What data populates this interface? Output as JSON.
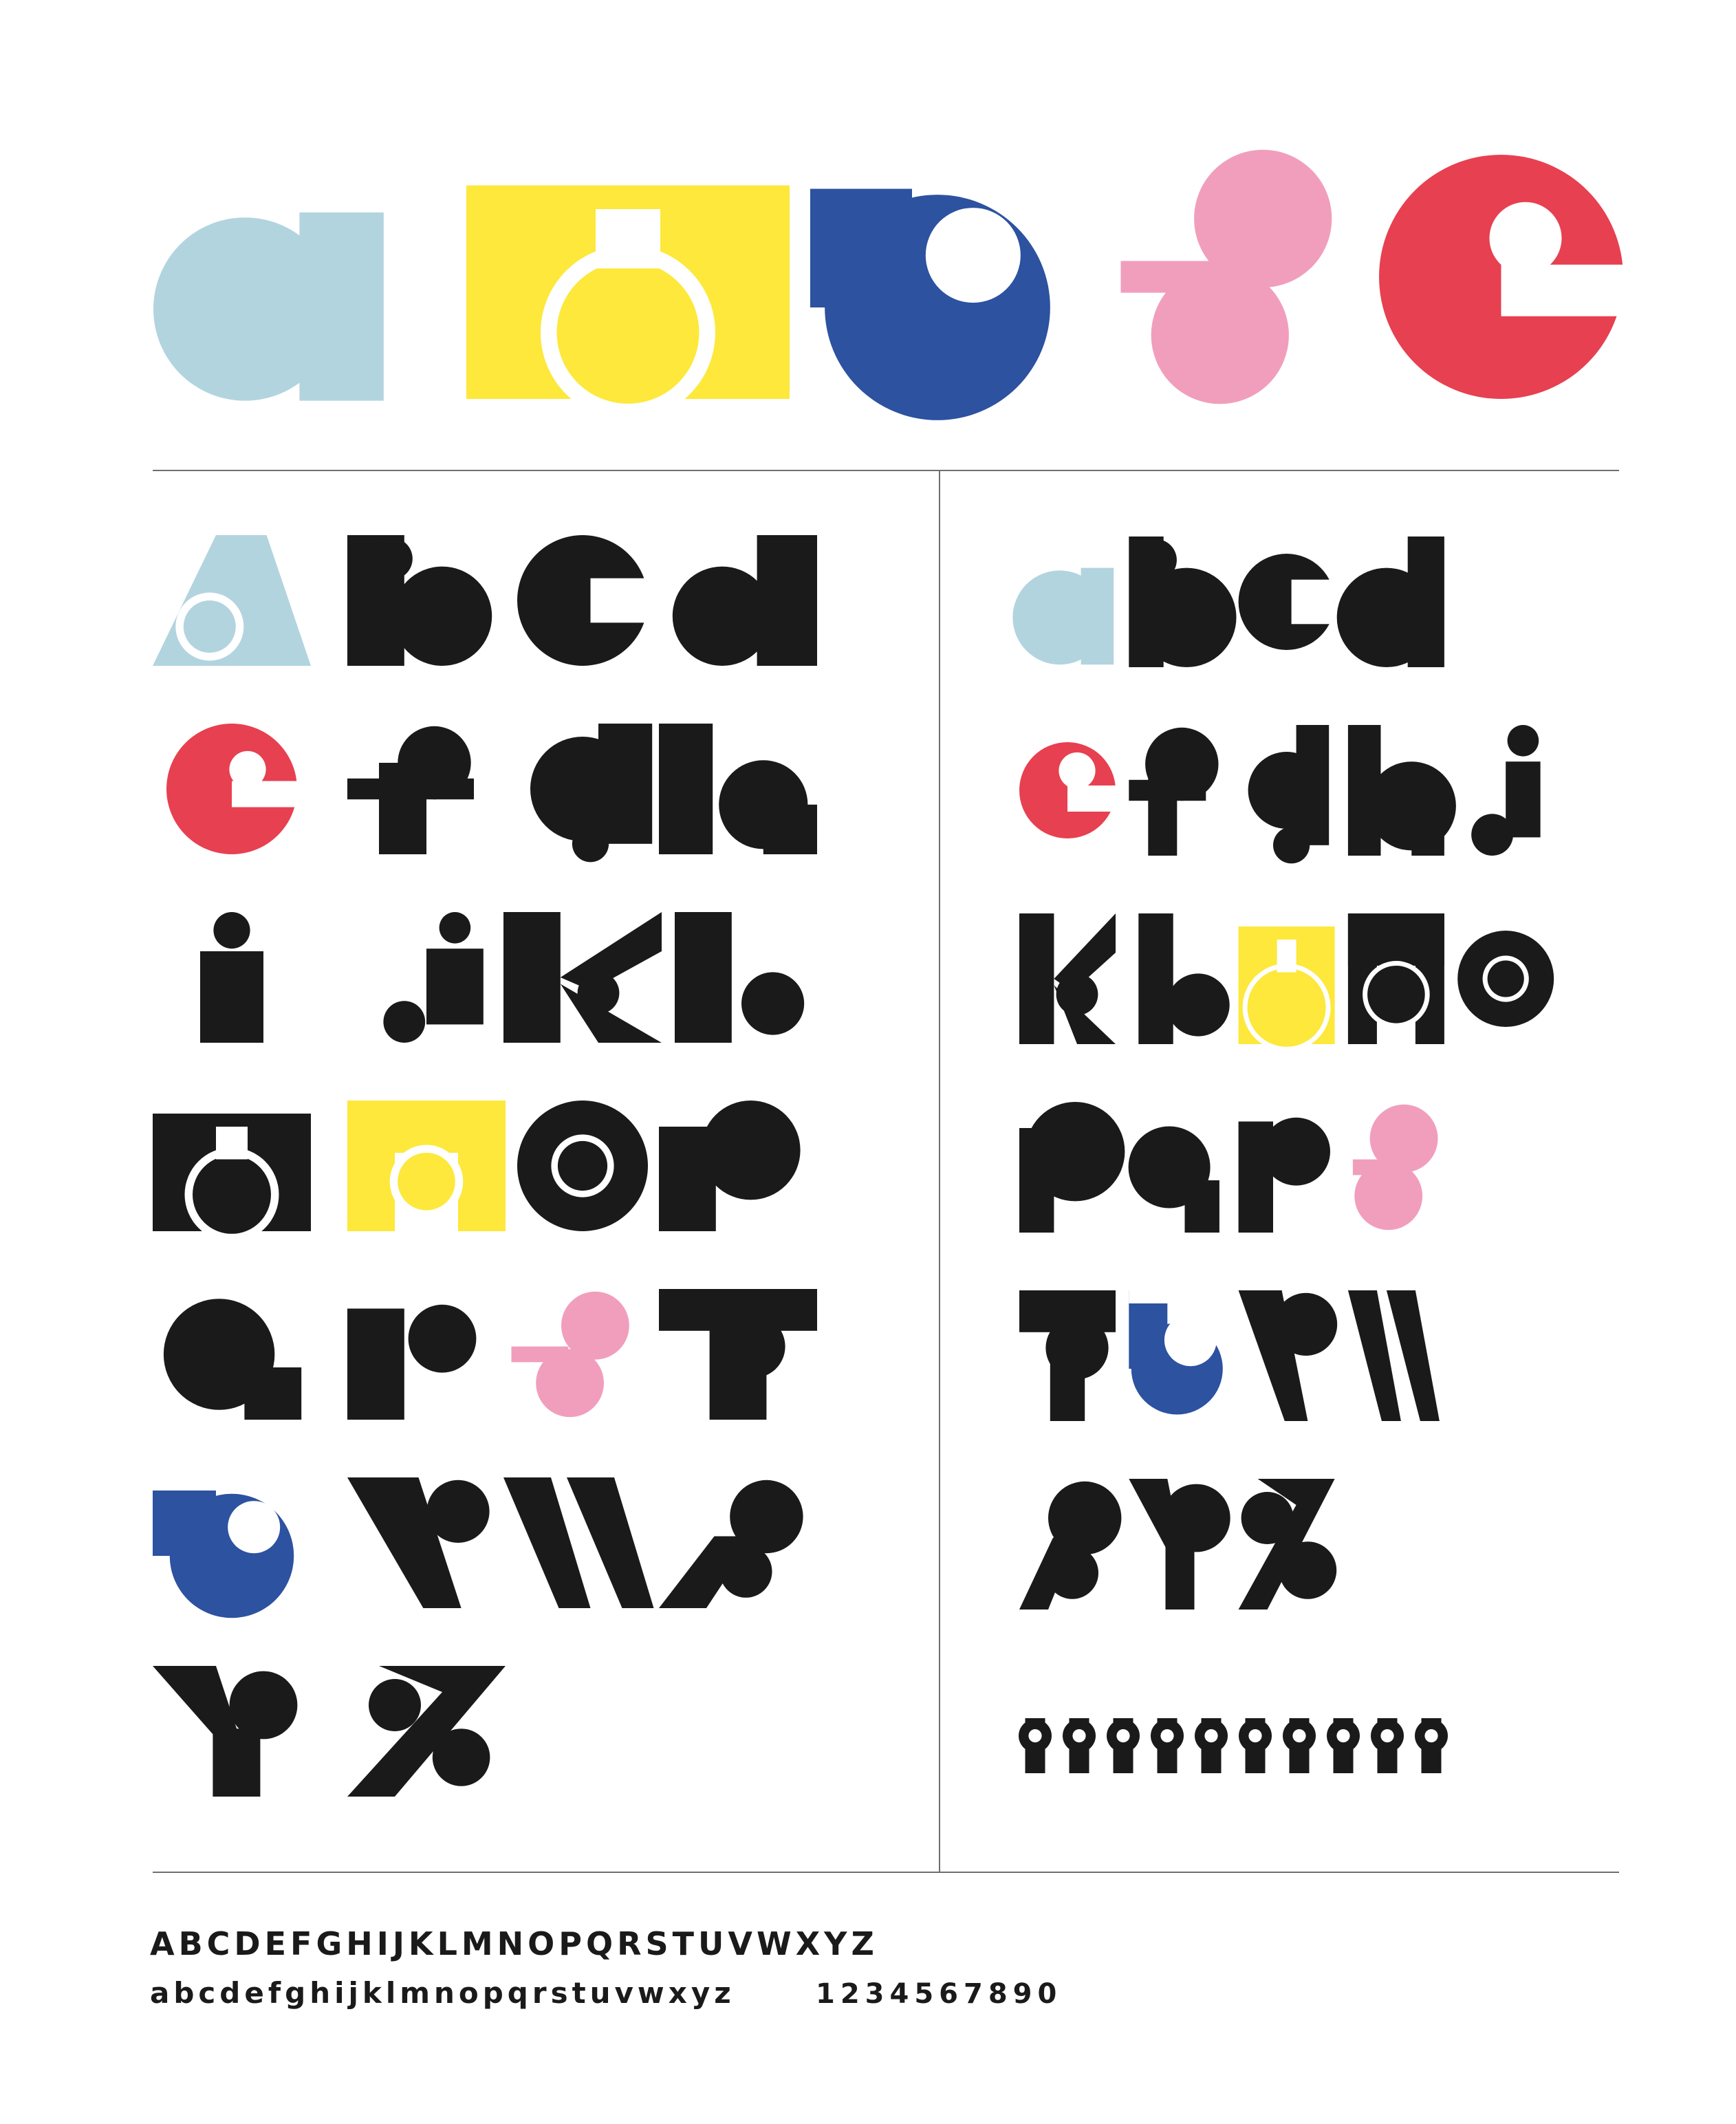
{
  "title": {
    "word": "amuse",
    "letters": [
      {
        "char": "a",
        "color": "#b2d4df"
      },
      {
        "char": "m",
        "color": "#fde83b"
      },
      {
        "char": "u",
        "color": "#2c52a0"
      },
      {
        "char": "s",
        "color": "#f19ebd"
      },
      {
        "char": "e",
        "color": "#e74050"
      }
    ]
  },
  "palette": {
    "ink": "#1a1a1a",
    "blue_light": "#b2d4df",
    "yellow": "#fde83b",
    "blue": "#2c52a0",
    "pink": "#f19ebd",
    "red": "#e74050",
    "rule": "#6e6e6e"
  },
  "uppercase": {
    "rows": [
      [
        {
          "char": "A",
          "color": "blue_light"
        },
        {
          "char": "B"
        },
        {
          "char": "C"
        },
        {
          "char": "D"
        }
      ],
      [
        {
          "char": "E",
          "color": "red"
        },
        {
          "char": "F"
        },
        {
          "char": "G"
        },
        {
          "char": "H"
        }
      ],
      [
        {
          "char": "I"
        },
        {
          "char": "J"
        },
        {
          "char": "K"
        },
        {
          "char": "L"
        }
      ],
      [
        {
          "char": "M"
        },
        {
          "char": "N",
          "color": "yellow"
        },
        {
          "char": "O"
        },
        {
          "char": "P"
        }
      ],
      [
        {
          "char": "Q"
        },
        {
          "char": "R"
        },
        {
          "char": "S",
          "color": "pink"
        },
        {
          "char": "T"
        }
      ],
      [
        {
          "char": "U",
          "color": "blue"
        },
        {
          "char": "V"
        },
        {
          "char": "W"
        },
        {
          "char": "X"
        }
      ],
      [
        {
          "char": "Y"
        },
        {
          "char": "Z"
        }
      ]
    ]
  },
  "lowercase": {
    "rows": [
      [
        {
          "char": "a",
          "color": "blue_light"
        },
        {
          "char": "b"
        },
        {
          "char": "c"
        },
        {
          "char": "d"
        }
      ],
      [
        {
          "char": "e",
          "color": "red"
        },
        {
          "char": "f"
        },
        {
          "char": "g"
        },
        {
          "char": "h"
        },
        {
          "char": "j"
        }
      ],
      [
        {
          "char": "k"
        },
        {
          "char": "l"
        },
        {
          "char": "m",
          "color": "yellow"
        },
        {
          "char": "n"
        },
        {
          "char": "o"
        }
      ],
      [
        {
          "char": "p"
        },
        {
          "char": "q"
        },
        {
          "char": "r"
        },
        {
          "char": "s",
          "color": "pink"
        }
      ],
      [
        {
          "char": "t"
        },
        {
          "char": "u",
          "color": "blue"
        },
        {
          "char": "v"
        },
        {
          "char": "w"
        }
      ],
      [
        {
          "char": "x"
        },
        {
          "char": "y"
        },
        {
          "char": "z"
        }
      ]
    ]
  },
  "numerals": "1234567890",
  "strip": {
    "uppercase": "ABCDEFGHIJKLMNOPQRSTUVWXYZ",
    "lowercase": "abcdefghijklmnopqrstuvwxyz",
    "numerals": "1234567890"
  }
}
